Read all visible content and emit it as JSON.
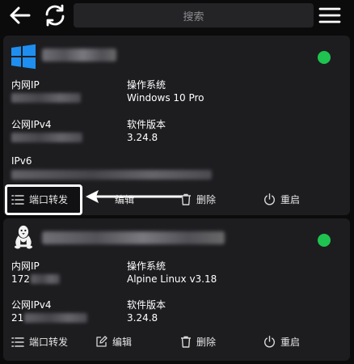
{
  "toolbar": {
    "back_icon": "arrow-left-icon",
    "refresh_icon": "refresh-icon",
    "search_placeholder": "搜索",
    "menu_icon": "hamburger-menu-icon"
  },
  "colors": {
    "background": "#0b0b0c",
    "card": "#1d1d20",
    "online": "#1fc34f"
  },
  "servers": [
    {
      "os_icon": "windows-logo-icon",
      "name": "",
      "status": "online",
      "intranet_ip_label": "内网IP",
      "intranet_ip": "",
      "os_label": "操作系统",
      "os": "Windows 10 Pro",
      "public_ipv4_label": "公网IPv4",
      "public_ipv4": "",
      "version_label": "软件版本",
      "version": "3.24.8",
      "ipv6_label": "IPv6",
      "ipv6": "",
      "actions": {
        "port_forward": "端口转发",
        "edit": "编辑",
        "delete": "删除",
        "restart": "重启"
      }
    },
    {
      "os_icon": "linux-penguin-icon",
      "name": "",
      "status": "online",
      "intranet_ip_label": "内网IP",
      "intranet_ip": "172",
      "os_label": "操作系统",
      "os": "Alpine Linux v3.18",
      "public_ipv4_label": "公网IPv4",
      "public_ipv4": "21",
      "version_label": "软件版本",
      "version": "3.24.8",
      "actions": {
        "port_forward": "端口转发",
        "edit": "编辑",
        "delete": "删除",
        "restart": "重启"
      }
    }
  ]
}
